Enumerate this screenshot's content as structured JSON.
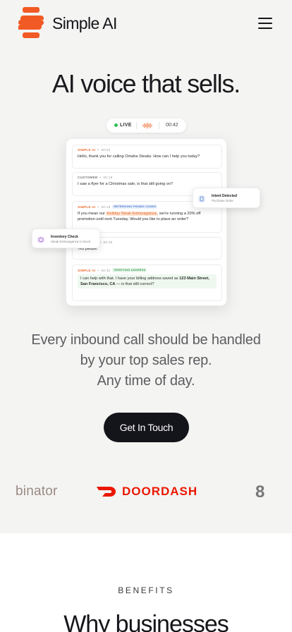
{
  "nav": {
    "brand": "Simple AI",
    "menu_icon": "hamburger-icon",
    "logo_color": "#f15a24"
  },
  "hero": {
    "title": "AI voice that sells.",
    "status": {
      "live": "LIVE",
      "time": "00:42"
    },
    "transcript": [
      {
        "speaker": "SIMPLE AI",
        "time": "00:02",
        "text": "Hello, thank you for calling Omaha Steaks. How can I help you today?"
      },
      {
        "speaker": "CUSTOMER",
        "time": "00:18",
        "text": "I saw a flyer for a Christmas sale, is that still going on?"
      },
      {
        "speaker": "SIMPLE AI",
        "time": "00:19",
        "tag": "RETRIEVING PROMO CODES",
        "text_before": "If you mean our ",
        "highlight": "Holiday Steak Extravaganza",
        "text_after": ", we're running a 20% off promotion until next Tuesday. Would you like to place an order?"
      },
      {
        "speaker": "CUSTOMER",
        "time": "00:28",
        "text": "Yes please."
      },
      {
        "speaker": "SIMPLE AI",
        "time": "00:32",
        "tag": "VERIFYING ADDRESS",
        "text_before": "I can help with that. I have your billing address saved as ",
        "bold": "123 Main Street, San Francisco, CA",
        "text_after": " — is that still correct?"
      }
    ],
    "intent_card": {
      "title": "Intent Detected",
      "subtitle": "Purchase Order"
    },
    "inventory_card": {
      "title": "Inventory Check",
      "subtitle": "Steak Extravaganza in Stock"
    },
    "tagline": [
      "Every inbound call should be handled",
      "by your top sales rep.",
      "Any time of day."
    ],
    "cta_label": "Get In Touch"
  },
  "logos": {
    "yc": "binator",
    "doordash": "DOORDASH",
    "partial": "8"
  },
  "benefits": {
    "eyebrow": "BENEFITS",
    "title": "Why businesses"
  }
}
